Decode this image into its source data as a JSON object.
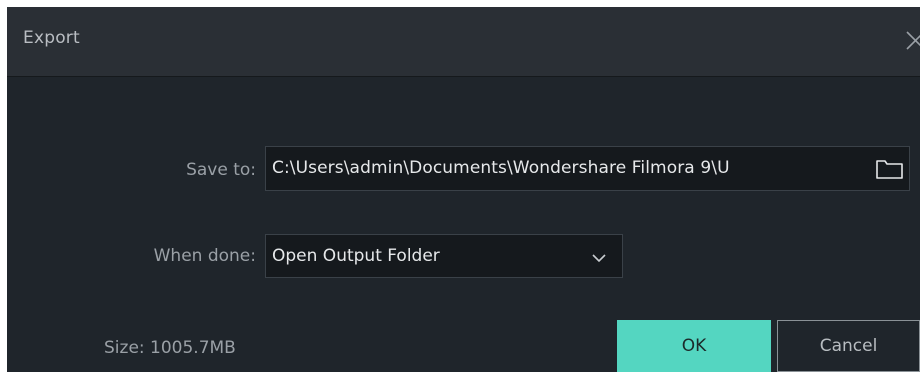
{
  "dialog": {
    "title": "Export",
    "close_icon": "close-icon"
  },
  "save_to": {
    "label": "Save to:",
    "value": "C:\\Users\\admin\\Documents\\Wondershare Filmora 9\\U",
    "folder_icon": "folder-icon"
  },
  "when_done": {
    "label": "When done:",
    "selected": "Open Output Folder",
    "dropdown_icon": "chevron-down-icon"
  },
  "size": {
    "label": "Size:",
    "value": "1005.7MB"
  },
  "buttons": {
    "ok": "OK",
    "cancel": "Cancel"
  },
  "colors": {
    "dialog_bg": "#1f252b",
    "titlebar_bg": "#2a2f35",
    "accent": "#54d6c1",
    "field_bg": "#15191d"
  }
}
